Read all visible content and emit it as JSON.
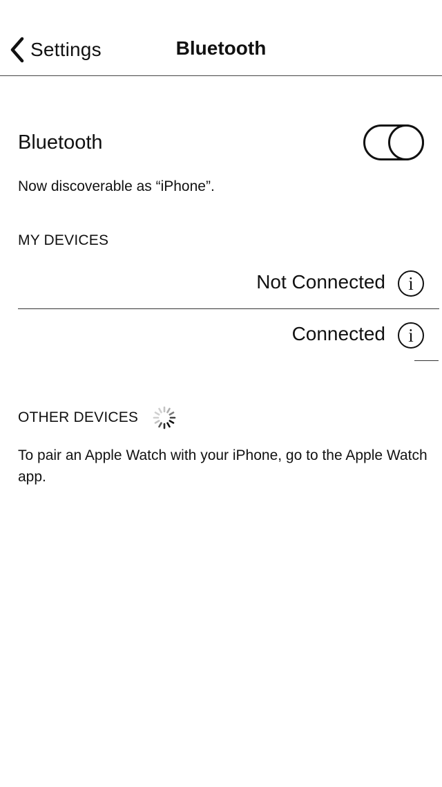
{
  "navbar": {
    "back_label": "Settings",
    "title": "Bluetooth"
  },
  "bluetooth": {
    "label": "Bluetooth",
    "enabled": true,
    "discoverable_text": "Now discoverable as “iPhone”."
  },
  "my_devices": {
    "header": "MY DEVICES",
    "items": [
      {
        "status": "Not Connected",
        "info_glyph": "i"
      },
      {
        "status": "Connected",
        "info_glyph": "i"
      }
    ]
  },
  "other_devices": {
    "header": "OTHER DEVICES",
    "note": "To pair an Apple Watch with your iPhone, go to the Apple Watch app."
  },
  "icons": {
    "back": "chevron-left-icon",
    "info": "info-icon",
    "spinner": "loading-spinner-icon"
  },
  "colors": {
    "text": "#111111",
    "background": "#ffffff",
    "separator": "#333333"
  }
}
